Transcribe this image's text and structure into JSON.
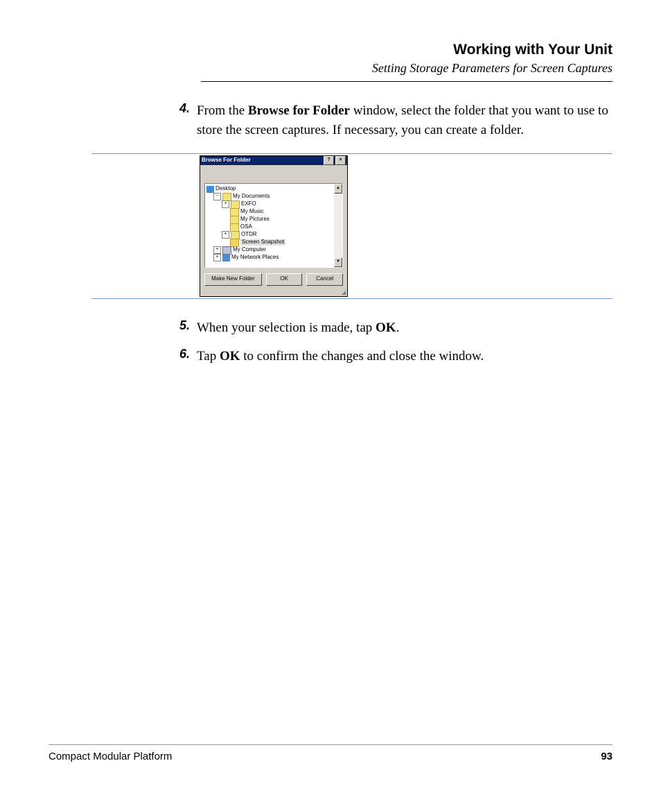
{
  "header": {
    "title": "Working with Your Unit",
    "subtitle": "Setting Storage Parameters for Screen Captures"
  },
  "steps": {
    "s4": {
      "num": "4.",
      "pre": "From the ",
      "bold1": "Browse for Folder",
      "post": " window, select the folder that you want to use to store the screen captures. If necessary, you can create a folder."
    },
    "s5": {
      "num": "5.",
      "pre": "When your selection is made, tap ",
      "bold1": "OK",
      "post": "."
    },
    "s6": {
      "num": "6.",
      "pre": "Tap ",
      "bold1": "OK",
      "post": " to confirm the changes and close the window."
    }
  },
  "dialog": {
    "title": "Browse For Folder",
    "help_glyph": "?",
    "close_glyph": "×",
    "tree": {
      "desktop": "Desktop",
      "mydocs": "My Documents",
      "exfo": "EXFO",
      "mymusic": "My Music",
      "mypics": "My Pictures",
      "osa": "OSA",
      "otdr": "OTDR",
      "screensnap": "Screen Snapshot",
      "mycomp": "My Computer",
      "mynet": "My Network Places"
    },
    "buttons": {
      "newfolder": "Make New Folder",
      "ok": "OK",
      "cancel": "Cancel"
    },
    "scroll_up": "▲",
    "scroll_down": "▼",
    "plus": "+",
    "minus": "−"
  },
  "footer": {
    "left": "Compact Modular Platform",
    "right": "93"
  }
}
